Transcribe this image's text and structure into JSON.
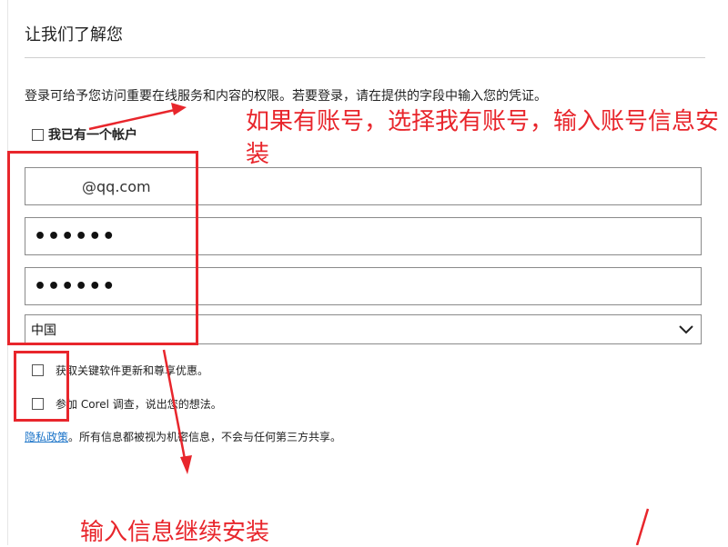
{
  "dialog": {
    "title": "让我们了解您",
    "description": "登录可给予您访问重要在线服务和内容的权限。若要登录，请在提供的字段中输入您的凭证。",
    "have_account_label": "我已有一个帐户",
    "email_value": "@qq.com",
    "password_value": "••••••",
    "confirm_password_value": "••••••",
    "country_value": "中国",
    "updates_label": "获取关键软件更新和尊享优惠。",
    "survey_label": "参加 Corel 调查，说出您的想法。",
    "privacy_link": "隐私政策",
    "privacy_text": "。所有信息都被视为机密信息，不会与任何第三方共享。"
  },
  "annotations": {
    "account_note": "如果有账号，选择我有账号，输入账号信息安装",
    "continue_note": "输入信息继续安装",
    "color": "#e8262c"
  },
  "icons": {
    "dropdown": "chevron-down-icon"
  }
}
